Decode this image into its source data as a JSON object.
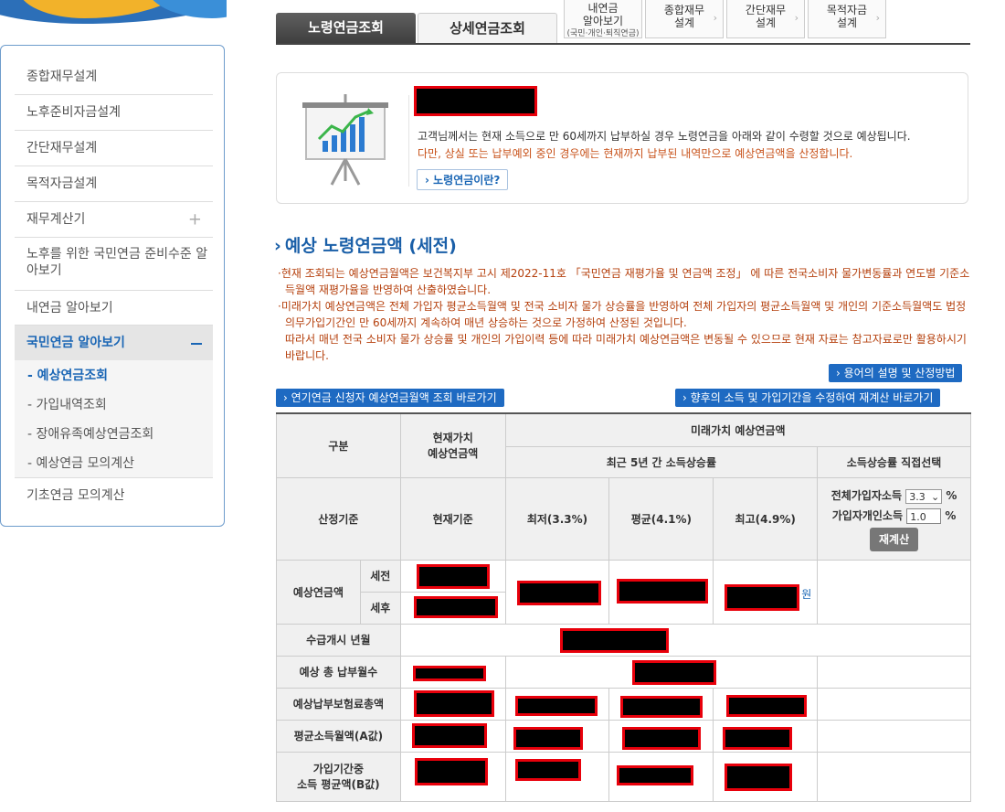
{
  "sidebar": {
    "items": [
      {
        "label": "종합재무설계"
      },
      {
        "label": "노후준비자금설계"
      },
      {
        "label": "간단재무설계"
      },
      {
        "label": "목적자금설계"
      },
      {
        "label": "재무계산기",
        "expand_icon": "plus-icon"
      },
      {
        "label": "노후를 위한 국민연금 준비수준 알아보기"
      },
      {
        "label": "내연금 알아보기"
      },
      {
        "label": "국민연금 알아보기",
        "collapse_icon": "minus-icon"
      },
      {
        "label": "기초연금 모의계산"
      }
    ],
    "sub_items": [
      {
        "label": "- 예상연금조회",
        "current": true
      },
      {
        "label": "- 가입내역조회"
      },
      {
        "label": "- 장애유족예상연금조회"
      },
      {
        "label": "- 예상연금 모의계산"
      }
    ]
  },
  "tabs": {
    "active": "노령연금조회",
    "inactive": "상세연금조회",
    "mini": [
      {
        "line1": "내연금",
        "line2": "알아보기",
        "sub": "(국민·개인·퇴직연금)"
      },
      {
        "line1": "종합재무",
        "line2": "설계"
      },
      {
        "line1": "간단재무",
        "line2": "설계"
      },
      {
        "line1": "목적자금",
        "line2": "설계"
      }
    ]
  },
  "intro": {
    "line1": "고객님께서는 현재 소득으로 만 60세까지 납부하실 경우 노령연금을 아래와 같이 수령할 것으로 예상됩니다.",
    "line2": "다만, 상실 또는 납부예외 중인 경우에는 현재까지 납부된 내역만으로 예상연금액을 산정합니다.",
    "button": "› 노령연금이란?"
  },
  "section": {
    "title": "예상 노령연금액 (세전)",
    "notes": [
      "·현재 조회되는 예상연금월액은 보건복지부 고시 제2022-11호 「국민연금 재평가율 및 연금액 조정」 에 따른 전국소비자 물가변동률과 연도별 기준소득월액 재평가율을 반영하여 산출하였습니다.",
      "·미래가치 예상연금액은 전체 가입자 평균소득월액 및 전국 소비자 물가 상승률을 반영하여 전체 가입자의 평균소득월액 및 개인의 기준소득월액도 법정 의무가입기간인 만 60세까지 계속하여 매년 상승하는 것으로 가정하여 산정된 것입니다.",
      "따라서 매년 전국 소비자 물가 상승률 및 개인의 가입이력 등에 따라 미래가치 예상연금액은 변동될 수 있으므로 현재 자료는 참고자료로만 활용하시기 바랍니다."
    ],
    "btn_terms": "› 용어의 설명 및 산정방법",
    "btn_deferred": "› 연기연금 신청자 예상연금월액 조회 바로가기",
    "btn_recalc_link": "› 향후의 소득 및 가입기간을 수정하여 재계산 바로가기"
  },
  "table": {
    "h_category": "구분",
    "h_present_line1": "현재가치",
    "h_present_line2": "예상연금액",
    "h_future": "미래가치 예상연금액",
    "h_recent": "최근 5년 간 소득상승률",
    "h_direct": "소득상승률 직접선택",
    "basis": "산정기준",
    "current_basis": "현재기준",
    "low": "최저(3.3%)",
    "avg": "평균(4.1%)",
    "high": "최고(4.9%)",
    "all_income_label": "전체가입자소득",
    "all_income_value": "3.3",
    "personal_income_label": "가입자개인소득",
    "personal_income_value": "1.0",
    "percent": "%",
    "recalc": "재계산",
    "expected_pension": "예상연금액",
    "pre_tax": "세전",
    "post_tax": "세후",
    "won": "원",
    "start_year": "수급개시 년월",
    "total_months": "예상 총 납부월수",
    "total_premium": "예상납부보험료총액",
    "avg_income": "평균소득월액(A값)",
    "period_line1": "가입기간중",
    "period_line2": "소득 평균액(B값)"
  },
  "colors": {
    "accent": "#1a66b5",
    "button_blue": "#1e6ac2",
    "note_text": "#b5400d",
    "redaction_border": "#e8000b"
  }
}
